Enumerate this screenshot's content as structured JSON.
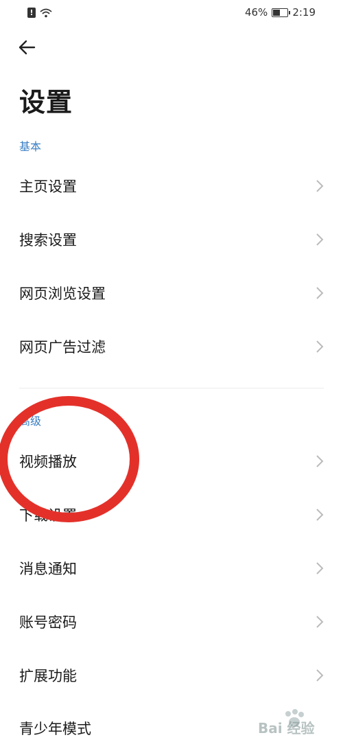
{
  "status_bar": {
    "battery_percent": "46%",
    "battery_level": 0.46,
    "time": "2:19",
    "icons": [
      "alert-icon",
      "wifi-icon",
      "battery-icon"
    ]
  },
  "header": {
    "back_icon": "arrow-left-icon",
    "title": "设置"
  },
  "sections": [
    {
      "label": "基本",
      "items": [
        {
          "label": "主页设置"
        },
        {
          "label": "搜索设置"
        },
        {
          "label": "网页浏览设置"
        },
        {
          "label": "网页广告过滤"
        }
      ]
    },
    {
      "label": "高级",
      "items": [
        {
          "label": "视频播放"
        },
        {
          "label": "下载设置"
        },
        {
          "label": "消息通知"
        },
        {
          "label": "账号密码"
        },
        {
          "label": "扩展功能"
        },
        {
          "label": "青少年模式"
        }
      ]
    }
  ],
  "colors": {
    "section_label": "#3b7fc4",
    "annotation": "#e3312a",
    "chevron": "#bbbbbb"
  },
  "watermark": {
    "text": "Bai 经验",
    "icon": "baidu-paw-icon"
  }
}
